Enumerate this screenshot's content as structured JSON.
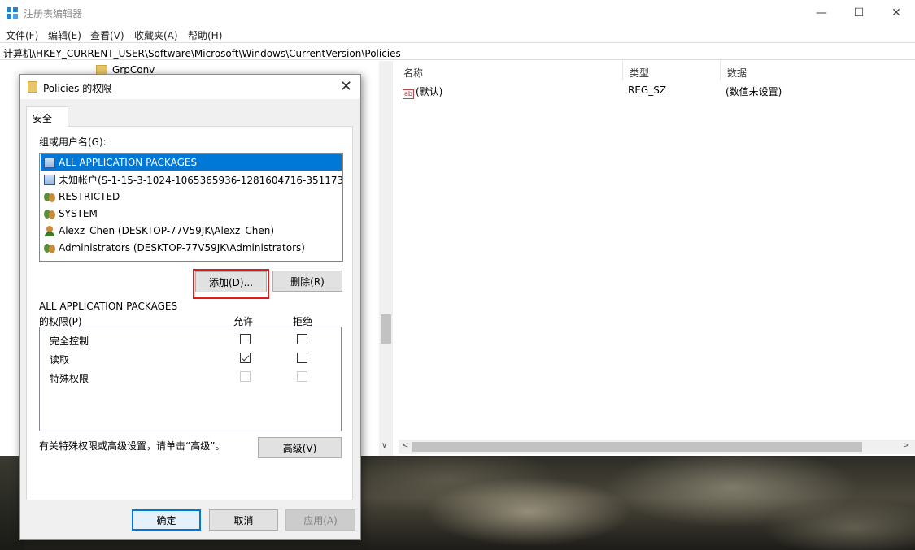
{
  "window": {
    "title": "注册表编辑器",
    "controls": {
      "minimize": "—",
      "maximize": "☐",
      "close": "✕"
    }
  },
  "menu": [
    "文件(F)",
    "编辑(E)",
    "查看(V)",
    "收藏夹(A)",
    "帮助(H)"
  ],
  "address": "计算机\\HKEY_CURRENT_USER\\Software\\Microsoft\\Windows\\CurrentVersion\\Policies",
  "tree": {
    "visible_item": "GrpConv"
  },
  "list": {
    "columns": [
      "名称",
      "类型",
      "数据"
    ],
    "rows": [
      {
        "name": "(默认)",
        "type": "REG_SZ",
        "data": "(数值未设置)"
      }
    ]
  },
  "dialog": {
    "title": "Policies 的权限",
    "tab": "安全",
    "group_label": "组或用户名(G):",
    "users": [
      {
        "name": "ALL APPLICATION PACKAGES",
        "icon": "package-icon",
        "selected": true
      },
      {
        "name": "未知帐户(S-1-15-3-1024-1065365936-1281604716-351173...",
        "icon": "package-icon",
        "selected": false
      },
      {
        "name": "RESTRICTED",
        "icon": "group-icon",
        "selected": false
      },
      {
        "name": "SYSTEM",
        "icon": "group-icon",
        "selected": false
      },
      {
        "name": "Alexz_Chen (DESKTOP-77V59JK\\Alexz_Chen)",
        "icon": "user-icon",
        "selected": false
      },
      {
        "name": "Administrators (DESKTOP-77V59JK\\Administrators)",
        "icon": "group-icon",
        "selected": false
      }
    ],
    "add_button": "添加(D)...",
    "remove_button": "删除(R)",
    "perm_header_line1": "ALL APPLICATION PACKAGES",
    "perm_header_line2": "的权限(P)",
    "allow_label": "允许",
    "deny_label": "拒绝",
    "permissions": [
      {
        "name": "完全控制",
        "allow": false,
        "deny": false,
        "enabled": true
      },
      {
        "name": "读取",
        "allow": true,
        "deny": false,
        "enabled": true
      },
      {
        "name": "特殊权限",
        "allow": false,
        "deny": false,
        "enabled": false
      }
    ],
    "advanced_hint": "有关特殊权限或高级设置，请单击“高级”。",
    "advanced_button": "高级(V)",
    "ok_button": "确定",
    "cancel_button": "取消",
    "apply_button": "应用(A)"
  }
}
